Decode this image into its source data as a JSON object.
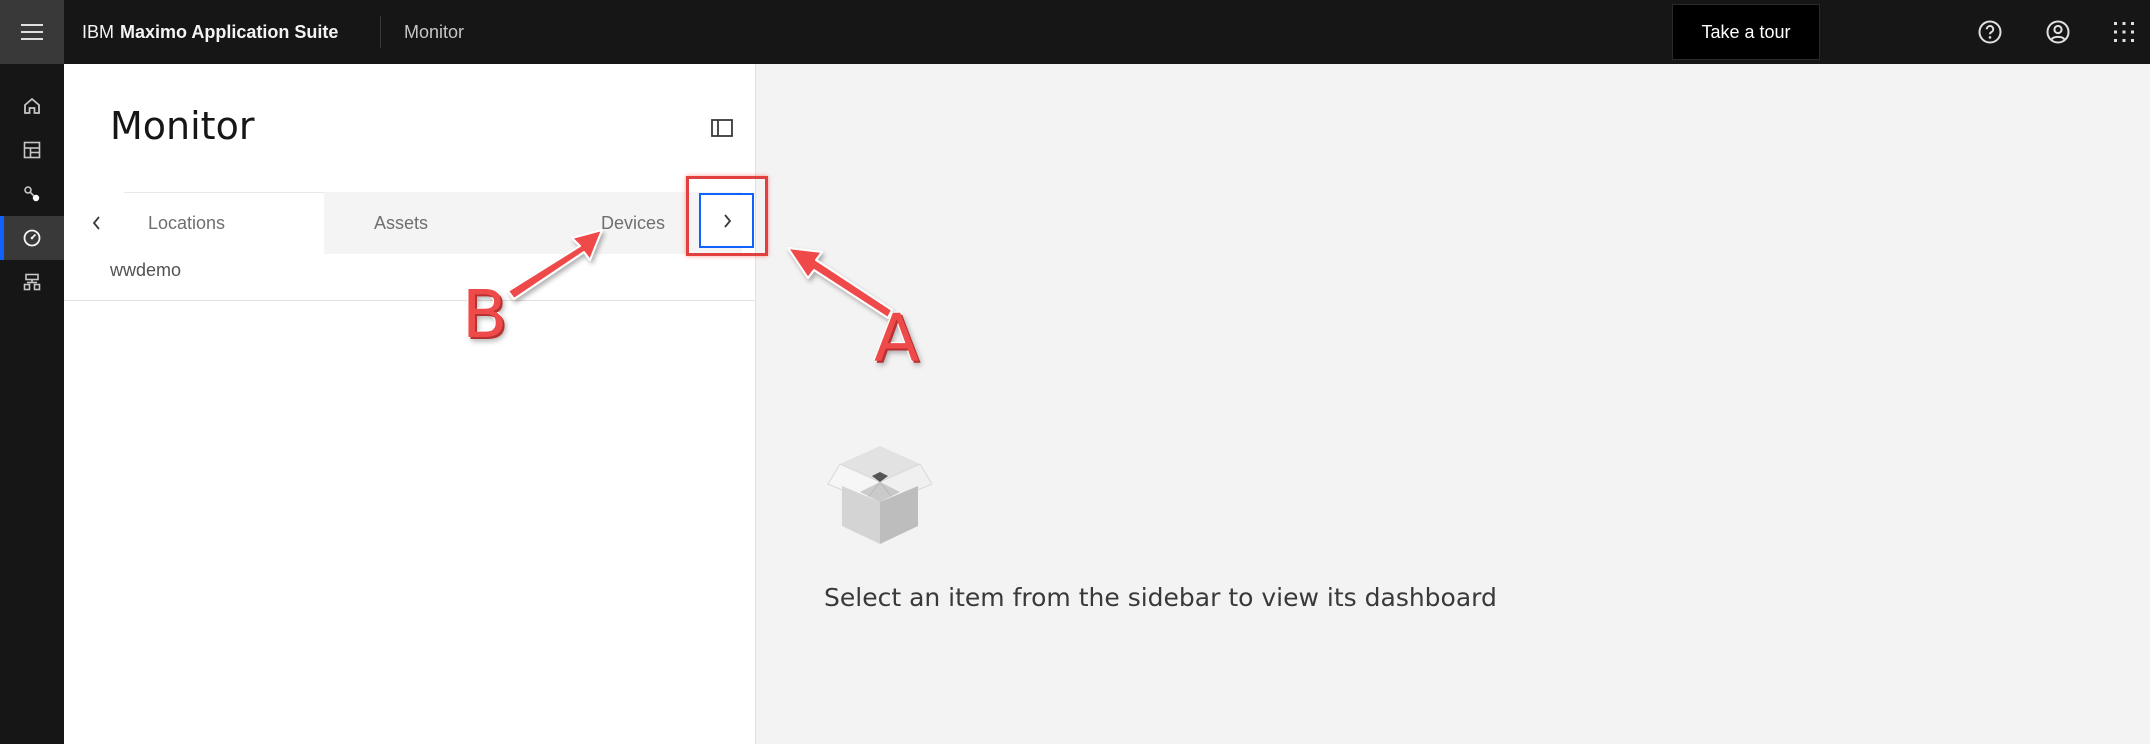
{
  "header": {
    "brand_ibm": "IBM",
    "brand_name": "Maximo Application Suite",
    "app_name": "Monitor",
    "tour_button": "Take a tour",
    "icons": [
      "menu-icon",
      "help-icon",
      "user-profile-icon",
      "app-switcher-icon"
    ]
  },
  "rail": {
    "items": [
      {
        "name": "home",
        "icon": "home-icon",
        "active": false
      },
      {
        "name": "dashboards",
        "icon": "dashboard-icon",
        "active": false
      },
      {
        "name": "setup",
        "icon": "connection-icon",
        "active": false
      },
      {
        "name": "monitor",
        "icon": "meter-icon",
        "active": true
      },
      {
        "name": "hierarchy",
        "icon": "hierarchy-icon",
        "active": false
      }
    ]
  },
  "sidebar": {
    "title": "Monitor",
    "tabs": [
      {
        "label": "Locations",
        "selected": true
      },
      {
        "label": "Assets",
        "selected": false
      },
      {
        "label": "Devices",
        "selected": false
      }
    ],
    "site": "wwdemo"
  },
  "main": {
    "empty_message": "Select an item from the sidebar to view its dashboard"
  },
  "annotations": {
    "a": "A",
    "b": "B",
    "color": "#ef4a4a"
  },
  "colors": {
    "header_bg": "#161616",
    "accent": "#0f62fe",
    "panel_bg": "#ffffff",
    "main_bg": "#f3f3f3"
  }
}
